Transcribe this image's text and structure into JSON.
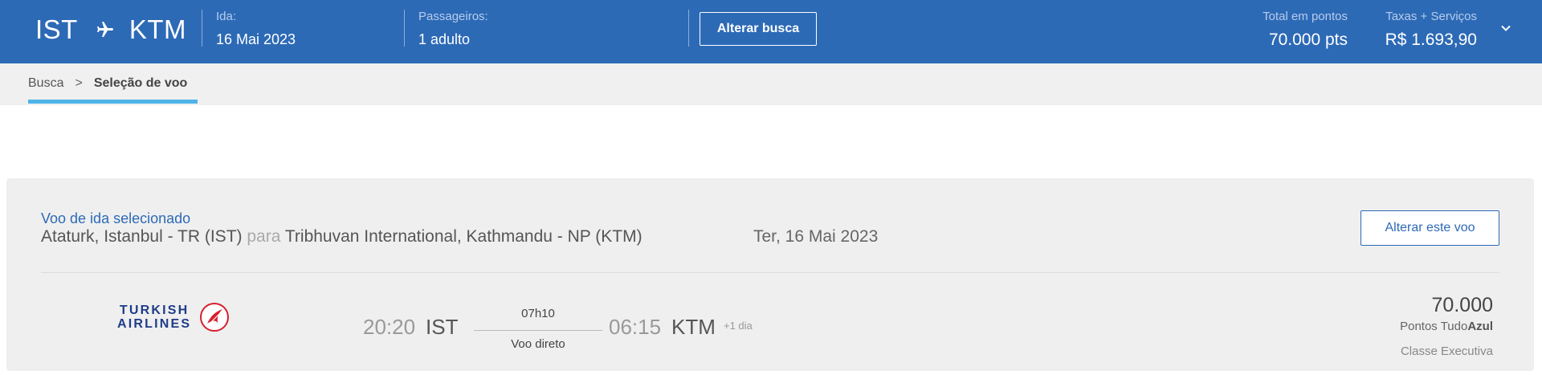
{
  "header": {
    "origin": "IST",
    "destination": "KTM",
    "departure_label": "Ida:",
    "departure_value": "16 Mai 2023",
    "passengers_label": "Passageiros:",
    "passengers_value": "1 adulto",
    "change_search_label": "Alterar busca",
    "points_label": "Total em pontos",
    "points_value": "70.000 pts",
    "taxes_label": "Taxas + Serviços",
    "taxes_value": "R$ 1.693,90",
    "icons": {
      "route": "airplane-icon",
      "expand": "chevron-down-icon"
    }
  },
  "breadcrumb": {
    "items": [
      "Busca",
      "Seleção de voo"
    ],
    "separator": ">"
  },
  "selected_flight": {
    "title": "Voo de ida selecionado",
    "origin": "Ataturk, Istanbul - TR (IST)",
    "connector": "para",
    "destination": "Tribhuvan International, Kathmandu - NP (KTM)",
    "date": "Ter, 16 Mai 2023",
    "change_flight_label": "Alterar este voo",
    "airline": {
      "line1": "TURKISH",
      "line2": "AIRLINES",
      "icon": "turkish-airlines-emblem-icon"
    },
    "departure_time": "20:20",
    "departure_code": "IST",
    "duration": "07h10",
    "stops": "Voo direto",
    "arrival_time": "06:15",
    "arrival_code": "KTM",
    "arrival_day_offset": "+1 dia",
    "price_points": "70.000",
    "price_label_prefix": "Pontos Tudo",
    "price_label_brand": "Azul",
    "cabin_class": "Classe Executiva"
  },
  "colors": {
    "header_bg": "#2d6ab6",
    "accent_underline": "#4fb3e8",
    "card_bg": "#efefef",
    "airline_red": "#d6202e",
    "airline_navy": "#1f3c8a"
  }
}
